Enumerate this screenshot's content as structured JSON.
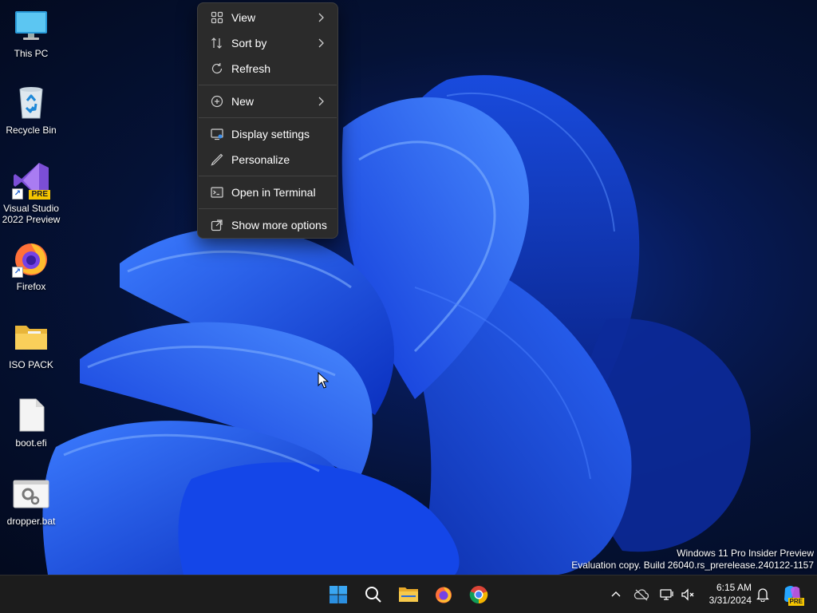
{
  "desktop": {
    "icons": [
      {
        "label_lines": [
          "This PC"
        ],
        "icon": "monitor-icon"
      },
      {
        "label_lines": [
          "Recycle Bin"
        ],
        "icon": "recycle-bin-icon"
      },
      {
        "label_lines": [
          "Visual Studio",
          "2022 Preview"
        ],
        "icon": "visual-studio-icon",
        "badge": "PRE"
      },
      {
        "label_lines": [
          "Firefox"
        ],
        "icon": "firefox-icon"
      },
      {
        "label_lines": [
          "ISO PACK"
        ],
        "icon": "folder-icon"
      },
      {
        "label_lines": [
          "boot.efi"
        ],
        "icon": "file-icon"
      },
      {
        "label_lines": [
          "dropper.bat"
        ],
        "icon": "batch-file-icon"
      }
    ]
  },
  "context_menu": {
    "items": [
      {
        "label": "View",
        "icon": "grid-icon",
        "submenu": true
      },
      {
        "label": "Sort by",
        "icon": "sort-icon",
        "submenu": true
      },
      {
        "label": "Refresh",
        "icon": "refresh-icon",
        "submenu": false
      },
      {
        "label": "New",
        "icon": "plus-circle-icon",
        "submenu": true
      },
      {
        "label": "Display settings",
        "icon": "display-settings-icon",
        "submenu": false
      },
      {
        "label": "Personalize",
        "icon": "pen-icon",
        "submenu": false
      },
      {
        "label": "Open in Terminal",
        "icon": "terminal-icon",
        "submenu": false
      },
      {
        "label": "Show more options",
        "icon": "open-external-icon",
        "submenu": false
      }
    ]
  },
  "watermark": {
    "line1": "Windows 11 Pro Insider Preview",
    "line2": "Evaluation copy. Build 26040.rs_prerelease.240122-1157"
  },
  "taskbar": {
    "pinned": [
      "windows-start-icon",
      "search-icon",
      "file-explorer-icon",
      "firefox-icon",
      "chrome-icon"
    ],
    "tray": [
      "chevron-up-icon",
      "onedrive-icon",
      "network-icon",
      "volume-icon",
      "notification-icon",
      "copilot-icon"
    ],
    "copilot_badge": "PRE",
    "clock": {
      "time": "6:15 AM",
      "date": "3/31/2024"
    }
  },
  "colors": {
    "accent": "#1a5fd0",
    "menu_bg": "#2b2b2b",
    "taskbar_bg": "#1c1c1c"
  }
}
